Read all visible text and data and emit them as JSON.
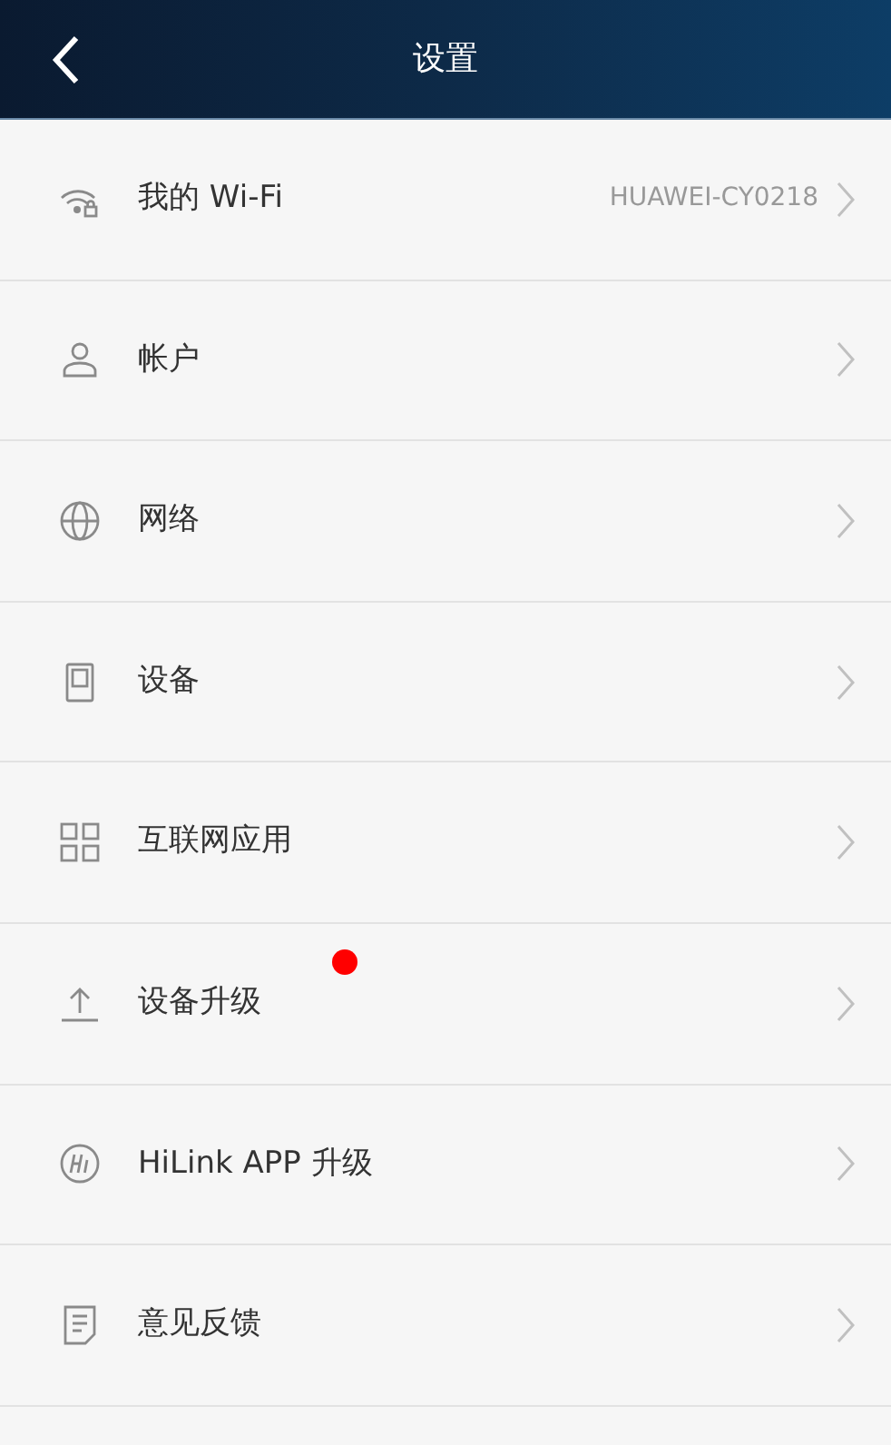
{
  "header": {
    "title": "设置"
  },
  "items": [
    {
      "kind": "wifi",
      "label": "我的 Wi-Fi",
      "value": "HUAWEI-CY0218",
      "badge": false
    },
    {
      "kind": "account",
      "label": "帐户",
      "badge": false
    },
    {
      "kind": "network",
      "label": "网络",
      "badge": false
    },
    {
      "kind": "device",
      "label": "设备",
      "badge": false
    },
    {
      "kind": "apps",
      "label": "互联网应用",
      "badge": false
    },
    {
      "kind": "upgrade",
      "label": "设备升级",
      "badge": true
    },
    {
      "kind": "hilink",
      "label": "HiLink APP 升级",
      "badge": false
    },
    {
      "kind": "feedback",
      "label": "意见反馈",
      "badge": false
    }
  ]
}
